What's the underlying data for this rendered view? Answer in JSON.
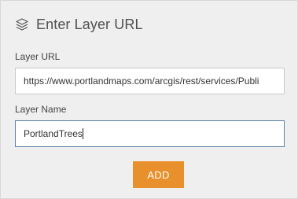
{
  "header": {
    "icon": "layers-icon",
    "title": "Enter Layer URL"
  },
  "form": {
    "url_label": "Layer URL",
    "url_value": "https://www.portlandmaps.com/arcgis/rest/services/Publi",
    "name_label": "Layer Name",
    "name_value": "PortlandTrees",
    "add_label": "ADD"
  },
  "colors": {
    "accent": "#e8912c",
    "focus_border": "#5a7fa8",
    "panel_bg": "#efefef"
  }
}
